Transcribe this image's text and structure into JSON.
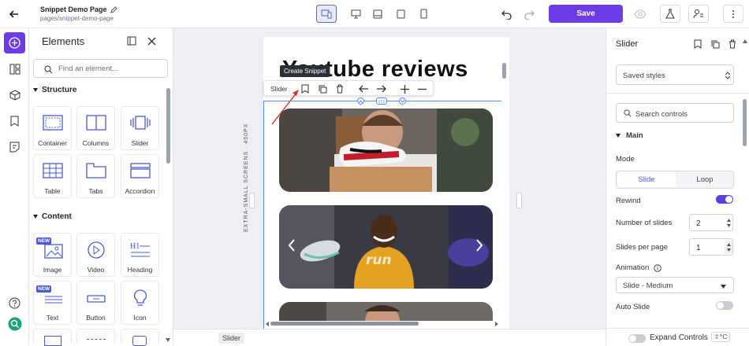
{
  "header": {
    "page_title": "Snippet Demo Page",
    "page_slug": "pages/snippet-demo-page",
    "save_label": "Save"
  },
  "elements_panel": {
    "title": "Elements",
    "search_placeholder": "Find an element...",
    "sections": [
      {
        "title": "Structure",
        "items": [
          "Container",
          "Columns",
          "Slider",
          "Table",
          "Tabs",
          "Accordion"
        ]
      },
      {
        "title": "Content",
        "items": [
          "Image",
          "Video",
          "Heading",
          "Text",
          "Button",
          "Icon"
        ]
      }
    ],
    "new_badge": "NEW"
  },
  "canvas": {
    "heading": "Youtube reviews",
    "tooltip": "Create Snippet",
    "toolbar_label": "Slider",
    "breakpoint_label": "EXTRA-SMALL SCREENS · 450PX",
    "slide_brand_text": "run"
  },
  "bottom_bar": {
    "breadcrumb": "Slider"
  },
  "right_panel": {
    "title": "Slider",
    "saved_styles": "Saved styles",
    "search_placeholder": "Search controls",
    "main_section": "Main",
    "mode_label": "Mode",
    "mode_options": [
      "Slide",
      "Loop"
    ],
    "mode_selected": "Slide",
    "rewind_label": "Rewind",
    "rewind_on": true,
    "number_of_slides_label": "Number of slides",
    "number_of_slides": "2",
    "slides_per_page_label": "Slides per page",
    "slides_per_page": "1",
    "animation_label": "Animation",
    "animation_value": "Slide - Medium",
    "auto_slide_label": "Auto Slide",
    "auto_slide_on": false,
    "expand_controls_label": "Expand Controls",
    "expand_shortcut": "⇧^C"
  },
  "colors": {
    "accent": "#6d3ce6",
    "selection": "#5b8cf0"
  }
}
